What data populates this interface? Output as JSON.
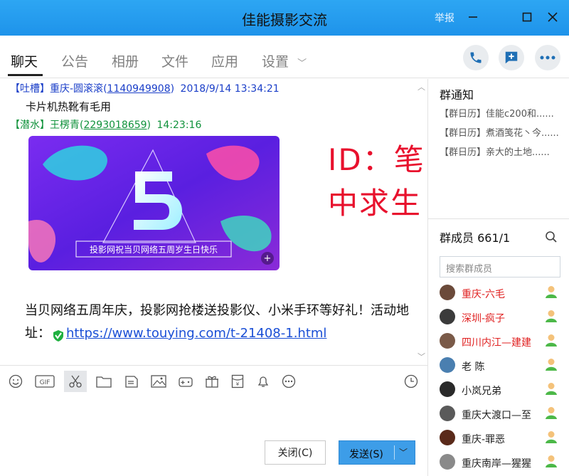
{
  "window": {
    "title": "佳能摄影交流",
    "report_label": "举报"
  },
  "tabs": [
    {
      "label": "聊天",
      "active": true
    },
    {
      "label": "公告"
    },
    {
      "label": "相册"
    },
    {
      "label": "文件"
    },
    {
      "label": "应用"
    },
    {
      "label": "设置"
    }
  ],
  "messages": [
    {
      "tag": "【吐槽】",
      "sender": "重庆-圆滚滚",
      "qq": "1140949908",
      "time": "2018/9/14 13:34:21",
      "text": "卡片机热靴有毛用"
    },
    {
      "tag": "【潜水】",
      "sender": "王楞青",
      "qq": "2293018659",
      "time": "14:23:16"
    }
  ],
  "poster": {
    "digit": "5",
    "caption": "投影网祝当贝网络五周岁生日快乐"
  },
  "long_message": {
    "text": "当贝网络五周年庆，投影网抢楼送投影仪、小米手环等好礼！活动地址：",
    "link": "https://www.touying.com/t-21408-1.html"
  },
  "watermark": "ID：笔中求生",
  "buttons": {
    "close": "关闭(C)",
    "send": "发送(S)"
  },
  "notice": {
    "title": "群通知",
    "items": [
      "【群日历】佳能c200和......",
      "【群日历】煮酒笺花丶今......",
      "【群日历】亲大的土地......"
    ]
  },
  "members": {
    "title": "群成员 661/1",
    "search_placeholder": "搜索群成员",
    "list": [
      {
        "name": "重庆-六毛",
        "color": "#e02020"
      },
      {
        "name": "深圳-疯子",
        "color": "#e02020"
      },
      {
        "name": "四川内江—建建",
        "color": "#e02020"
      },
      {
        "name": "老 陈",
        "color": "#222222"
      },
      {
        "name": "小岚兄弟",
        "color": "#222222"
      },
      {
        "name": "重庆大渡口—至",
        "color": "#222222"
      },
      {
        "name": "重庆-罪恶",
        "color": "#222222"
      },
      {
        "name": "重庆南岸—猩猩",
        "color": "#222222"
      }
    ]
  },
  "colors": {
    "accent": "#1e93ea",
    "send": "#3d9de8",
    "link": "#1a4fd6"
  }
}
